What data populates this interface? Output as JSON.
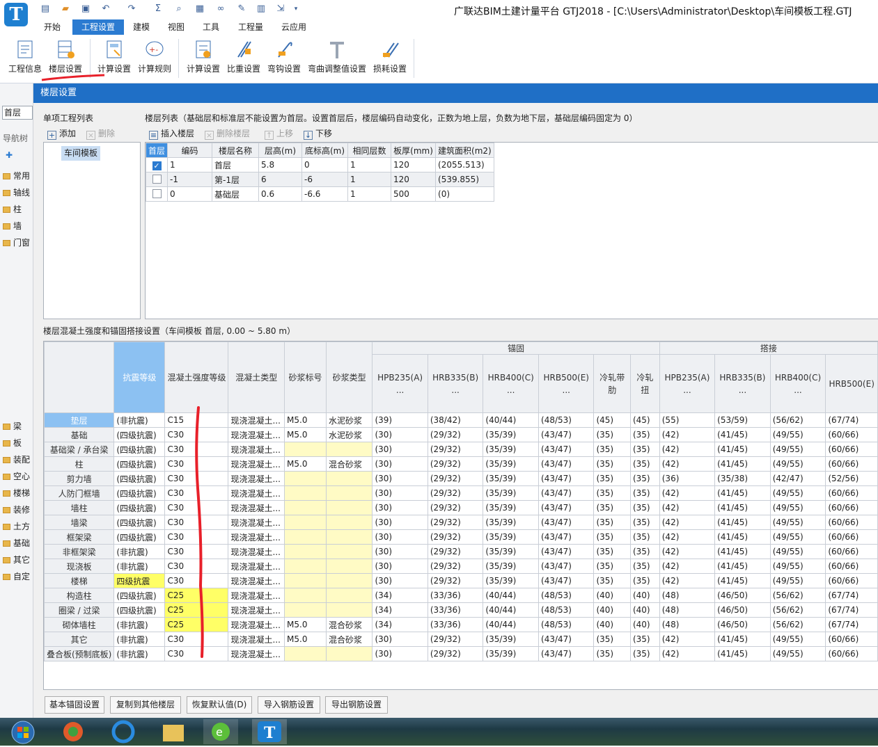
{
  "window": {
    "title": "广联达BIM土建计量平台 GTJ2018 - [C:\\Users\\Administrator\\Desktop\\车间模板工程.GTJ"
  },
  "quick_access": [
    "save",
    "open",
    "save-disk",
    "undo",
    "redo",
    "sum",
    "find",
    "view",
    "measure",
    "edit",
    "grid",
    "export",
    "more"
  ],
  "menu_tabs": [
    "开始",
    "工程设置",
    "建模",
    "视图",
    "工具",
    "工程量",
    "云应用"
  ],
  "ribbon": {
    "groups": [
      [
        "工程信息",
        "楼层设置"
      ],
      [
        "计算设置",
        "计算规则"
      ],
      [
        "计算设置",
        "比重设置",
        "弯钩设置",
        "弯曲调整值设置",
        "损耗设置"
      ]
    ]
  },
  "left_panel": {
    "floor": "首层",
    "nav": "导航树",
    "items": [
      "常用",
      "轴线",
      "柱",
      "墙",
      "门窗"
    ],
    "items2": [
      "梁",
      "板",
      "装配",
      "空心",
      "楼梯",
      "装修",
      "土方",
      "基础",
      "其它",
      "自定"
    ]
  },
  "dialog": {
    "title": "楼层设置",
    "project_list_label": "单项工程列表",
    "add": "添加",
    "delete": "删除",
    "project": "车间模板",
    "floor_list_label": "楼层列表（基础层和标准层不能设置为首层。设置首层后，楼层编码自动变化，正数为地上层，负数为地下层，基础层编码固定为 0）",
    "insert_floor": "插入楼层",
    "delete_floor": "删除楼层",
    "move_up": "上移",
    "move_down": "下移",
    "floor_headers": [
      "首层",
      "编码",
      "楼层名称",
      "层高(m)",
      "底标高(m)",
      "相同层数",
      "板厚(mm)",
      "建筑面积(m2)"
    ],
    "floors": [
      {
        "checked": true,
        "code": "1",
        "name": "首层",
        "height": "5.8",
        "bottom": "0",
        "same": "1",
        "thick": "120",
        "area": "(2055.513)"
      },
      {
        "checked": false,
        "code": "-1",
        "name": "第-1层",
        "height": "6",
        "bottom": "-6",
        "same": "1",
        "thick": "120",
        "area": "(539.855)"
      },
      {
        "checked": false,
        "code": "0",
        "name": "基础层",
        "height": "0.6",
        "bottom": "-6.6",
        "same": "1",
        "thick": "500",
        "area": "(0)"
      }
    ],
    "concrete_label": "楼层混凝土强度和锚固搭接设置（车间模板  首层, 0.00 ~ 5.80 m）",
    "concrete_top_headers": {
      "anchor": "锚固",
      "lap": "搭接"
    },
    "concrete_headers": [
      "抗震等级",
      "混凝土强度等级",
      "混凝土类型",
      "砂浆标号",
      "砂浆类型",
      "HPB235(A)\n...",
      "HRB335(B)\n...",
      "HRB400(C)\n...",
      "HRB500(E)\n...",
      "冷轧带肋",
      "冷轧扭",
      "HPB235(A)\n...",
      "HRB335(B)\n...",
      "HRB400(C)\n...",
      "HRB500(E)"
    ],
    "concrete_rows": [
      {
        "name": "垫层",
        "v": [
          "(非抗震)",
          "C15",
          "现浇混凝土...",
          "M5.0",
          "水泥砂浆",
          "(39)",
          "(38/42)",
          "(40/44)",
          "(48/53)",
          "(45)",
          "(45)",
          "(55)",
          "(53/59)",
          "(56/62)",
          "(67/74)"
        ]
      },
      {
        "name": "基础",
        "v": [
          "(四级抗震)",
          "C30",
          "现浇混凝土...",
          "M5.0",
          "水泥砂浆",
          "(30)",
          "(29/32)",
          "(35/39)",
          "(43/47)",
          "(35)",
          "(35)",
          "(42)",
          "(41/45)",
          "(49/55)",
          "(60/66)"
        ]
      },
      {
        "name": "基础梁 / 承台梁",
        "v": [
          "(四级抗震)",
          "C30",
          "现浇混凝土...",
          "",
          "",
          "(30)",
          "(29/32)",
          "(35/39)",
          "(43/47)",
          "(35)",
          "(35)",
          "(42)",
          "(41/45)",
          "(49/55)",
          "(60/66)"
        ]
      },
      {
        "name": "柱",
        "v": [
          "(四级抗震)",
          "C30",
          "现浇混凝土...",
          "M5.0",
          "混合砂浆",
          "(30)",
          "(29/32)",
          "(35/39)",
          "(43/47)",
          "(35)",
          "(35)",
          "(42)",
          "(41/45)",
          "(49/55)",
          "(60/66)"
        ]
      },
      {
        "name": "剪力墙",
        "v": [
          "(四级抗震)",
          "C30",
          "现浇混凝土...",
          "",
          "",
          "(30)",
          "(29/32)",
          "(35/39)",
          "(43/47)",
          "(35)",
          "(35)",
          "(36)",
          "(35/38)",
          "(42/47)",
          "(52/56)"
        ]
      },
      {
        "name": "人防门框墙",
        "v": [
          "(四级抗震)",
          "C30",
          "现浇混凝土...",
          "",
          "",
          "(30)",
          "(29/32)",
          "(35/39)",
          "(43/47)",
          "(35)",
          "(35)",
          "(42)",
          "(41/45)",
          "(49/55)",
          "(60/66)"
        ]
      },
      {
        "name": "墙柱",
        "v": [
          "(四级抗震)",
          "C30",
          "现浇混凝土...",
          "",
          "",
          "(30)",
          "(29/32)",
          "(35/39)",
          "(43/47)",
          "(35)",
          "(35)",
          "(42)",
          "(41/45)",
          "(49/55)",
          "(60/66)"
        ]
      },
      {
        "name": "墙梁",
        "v": [
          "(四级抗震)",
          "C30",
          "现浇混凝土...",
          "",
          "",
          "(30)",
          "(29/32)",
          "(35/39)",
          "(43/47)",
          "(35)",
          "(35)",
          "(42)",
          "(41/45)",
          "(49/55)",
          "(60/66)"
        ]
      },
      {
        "name": "框架梁",
        "v": [
          "(四级抗震)",
          "C30",
          "现浇混凝土...",
          "",
          "",
          "(30)",
          "(29/32)",
          "(35/39)",
          "(43/47)",
          "(35)",
          "(35)",
          "(42)",
          "(41/45)",
          "(49/55)",
          "(60/66)"
        ]
      },
      {
        "name": "非框架梁",
        "v": [
          "(非抗震)",
          "C30",
          "现浇混凝土...",
          "",
          "",
          "(30)",
          "(29/32)",
          "(35/39)",
          "(43/47)",
          "(35)",
          "(35)",
          "(42)",
          "(41/45)",
          "(49/55)",
          "(60/66)"
        ]
      },
      {
        "name": "现浇板",
        "v": [
          "(非抗震)",
          "C30",
          "现浇混凝土...",
          "",
          "",
          "(30)",
          "(29/32)",
          "(35/39)",
          "(43/47)",
          "(35)",
          "(35)",
          "(42)",
          "(41/45)",
          "(49/55)",
          "(60/66)"
        ]
      },
      {
        "name": "楼梯",
        "v": [
          "四级抗震",
          "C30",
          "现浇混凝土...",
          "",
          "",
          "(30)",
          "(29/32)",
          "(35/39)",
          "(43/47)",
          "(35)",
          "(35)",
          "(42)",
          "(41/45)",
          "(49/55)",
          "(60/66)"
        ]
      },
      {
        "name": "构造柱",
        "v": [
          "(四级抗震)",
          "C25",
          "现浇混凝土...",
          "",
          "",
          "(34)",
          "(33/36)",
          "(40/44)",
          "(48/53)",
          "(40)",
          "(40)",
          "(48)",
          "(46/50)",
          "(56/62)",
          "(67/74)"
        ]
      },
      {
        "name": "圈梁 / 过梁",
        "v": [
          "(四级抗震)",
          "C25",
          "现浇混凝土...",
          "",
          "",
          "(34)",
          "(33/36)",
          "(40/44)",
          "(48/53)",
          "(40)",
          "(40)",
          "(48)",
          "(46/50)",
          "(56/62)",
          "(67/74)"
        ]
      },
      {
        "name": "砌体墙柱",
        "v": [
          "(非抗震)",
          "C25",
          "现浇混凝土...",
          "M5.0",
          "混合砂浆",
          "(34)",
          "(33/36)",
          "(40/44)",
          "(48/53)",
          "(40)",
          "(40)",
          "(48)",
          "(46/50)",
          "(56/62)",
          "(67/74)"
        ]
      },
      {
        "name": "其它",
        "v": [
          "(非抗震)",
          "C30",
          "现浇混凝土...",
          "M5.0",
          "混合砂浆",
          "(30)",
          "(29/32)",
          "(35/39)",
          "(43/47)",
          "(35)",
          "(35)",
          "(42)",
          "(41/45)",
          "(49/55)",
          "(60/66)"
        ]
      },
      {
        "name": "叠合板(预制底板)",
        "v": [
          "(非抗震)",
          "C30",
          "现浇混凝土...",
          "",
          "",
          "(30)",
          "(29/32)",
          "(35/39)",
          "(43/47)",
          "(35)",
          "(35)",
          "(42)",
          "(41/45)",
          "(49/55)",
          "(60/66)"
        ]
      }
    ],
    "buttons": [
      "基本锚固设置",
      "复制到其他楼层",
      "恢复默认值(D)",
      "导入钢筋设置",
      "导出钢筋设置"
    ]
  },
  "colors": {
    "accent": "#2b7bd1",
    "dialog_title": "#1f6fc6",
    "selected_header": "#8cc1f2",
    "editable_cell": "#fffbc5",
    "modified_cell": "#ffff66",
    "annotation_red": "#e8202a"
  }
}
